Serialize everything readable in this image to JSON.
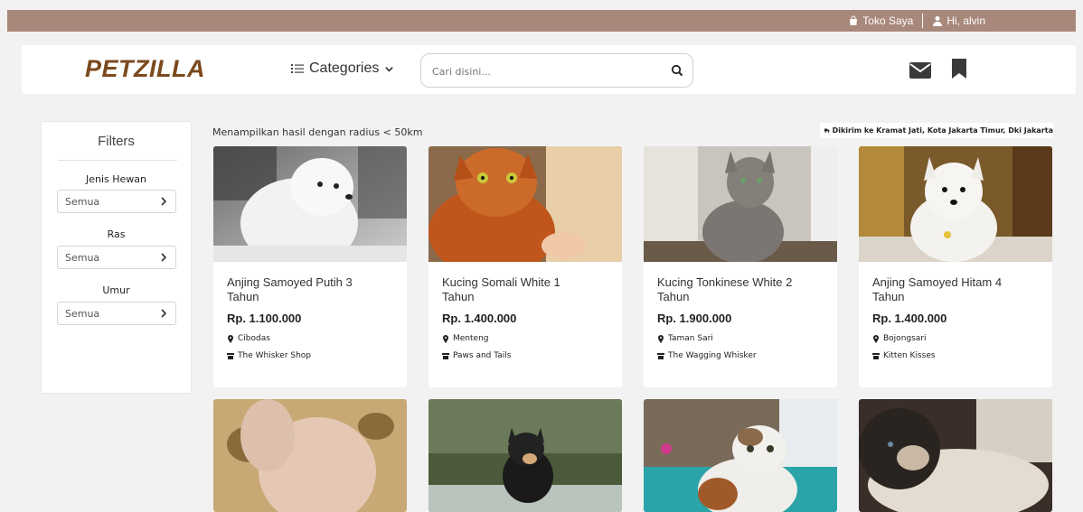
{
  "topbar": {
    "shop_label": "Toko Saya",
    "user_label": "Hi, alvin"
  },
  "header": {
    "logo": "PETZILLA",
    "categories_label": "Categories",
    "search_placeholder": "Cari disini..."
  },
  "filters": {
    "title": "Filters",
    "groups": [
      {
        "label": "Jenis Hewan",
        "value": "Semua"
      },
      {
        "label": "Ras",
        "value": "Semua"
      },
      {
        "label": "Umur",
        "value": "Semua"
      }
    ]
  },
  "results": {
    "summary": "Menampilkan hasil dengan radius < 50km",
    "delivery": "Dikirim ke Kramat Jati, Kota Jakarta Timur, Dki Jakarta"
  },
  "products": [
    {
      "name": "Anjing Samoyed Putih 3 Tahun",
      "price": "Rp. 1.100.000",
      "location": "Cibodas",
      "shop": "The Whisker Shop",
      "image": "white-samoyed-dog-photo"
    },
    {
      "name": "Kucing Somali White 1 Tahun",
      "price": "Rp. 1.400.000",
      "location": "Menteng",
      "shop": "Paws and Tails",
      "image": "orange-somali-cat-photo"
    },
    {
      "name": "Kucing Tonkinese White 2 Tahun",
      "price": "Rp. 1.900.000",
      "location": "Taman Sari",
      "shop": "The Wagging Whisker",
      "image": "grey-tonkinese-cat-photo"
    },
    {
      "name": "Anjing Samoyed Hitam 4 Tahun",
      "price": "Rp. 1.400.000",
      "location": "Bojongsari",
      "shop": "Kitten Kisses",
      "image": "samoyed-dog-indoor-photo"
    },
    {
      "image": "hairless-sphynx-cat-photo"
    },
    {
      "image": "black-shiba-dog-photo"
    },
    {
      "image": "calico-scottish-fold-cat-photo"
    },
    {
      "image": "siamese-cat-photo"
    }
  ],
  "colors": {
    "topbar": "#a8887a",
    "logo": "#7b4a1e",
    "icon_dark": "#3a3a3a"
  }
}
